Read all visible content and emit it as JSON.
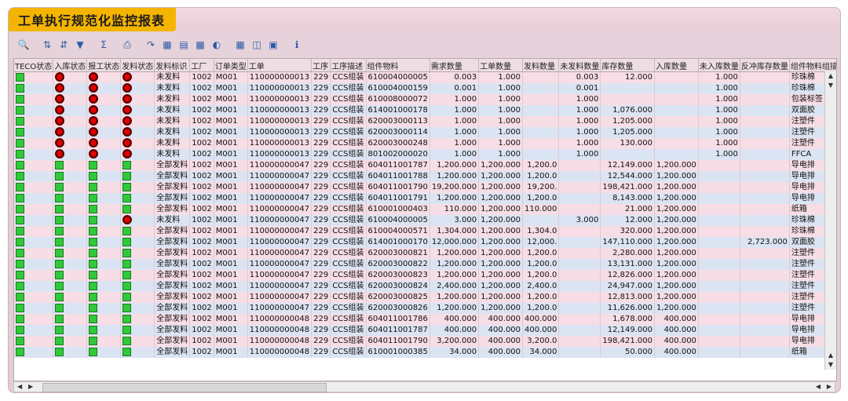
{
  "title": "工单执行规范化监控报表",
  "toolbar": {
    "icons": [
      "details-icon",
      "sort-ascending-icon",
      "sort-descending-icon",
      "filter-icon",
      "sum-icon",
      "print-icon",
      "export-icon",
      "spreadsheet-icon",
      "word-processing-icon",
      "graphic-icon",
      "abc-analysis-icon",
      "layout-icon",
      "select-layout-icon",
      "save-layout-icon",
      "info-icon"
    ]
  },
  "table": {
    "columns": [
      "TECO状态",
      "入库状态",
      "报工状态",
      "发料状态",
      "发料标识",
      "工厂",
      "订单类型",
      "工单",
      "工序",
      "工序描述",
      "组件物料",
      "需求数量",
      "工单数量",
      "发料数量",
      "未发料数量",
      "库存数量",
      "入库数量",
      "未入库数量",
      "反冲库存数量",
      "组件物料组描"
    ],
    "rows": [
      {
        "teco": "g",
        "in": "r",
        "rep": "r",
        "iss": "r",
        "flag": "未发料",
        "plant": "1002",
        "type": "M001",
        "order": "110000000013",
        "op": "229",
        "opdesc": "CCS组装",
        "mat": "610004000005",
        "req": "0.003",
        "ord": "1.000",
        "isq": "",
        "unis": "0.003",
        "stock": "12.000",
        "inq": "",
        "unin": "1.000",
        "back": "",
        "grp": "珍珠棉"
      },
      {
        "teco": "g",
        "in": "r",
        "rep": "r",
        "iss": "r",
        "flag": "未发料",
        "plant": "1002",
        "type": "M001",
        "order": "110000000013",
        "op": "229",
        "opdesc": "CCS组装",
        "mat": "610004000159",
        "req": "0.001",
        "ord": "1.000",
        "isq": "",
        "unis": "0.001",
        "stock": "",
        "inq": "",
        "unin": "1.000",
        "back": "",
        "grp": "珍珠棉"
      },
      {
        "teco": "g",
        "in": "r",
        "rep": "r",
        "iss": "r",
        "flag": "未发料",
        "plant": "1002",
        "type": "M001",
        "order": "110000000013",
        "op": "229",
        "opdesc": "CCS组装",
        "mat": "610008000072",
        "req": "1.000",
        "ord": "1.000",
        "isq": "",
        "unis": "1.000",
        "stock": "",
        "inq": "",
        "unin": "1.000",
        "back": "",
        "grp": "包装标签"
      },
      {
        "teco": "g",
        "in": "r",
        "rep": "r",
        "iss": "r",
        "flag": "未发料",
        "plant": "1002",
        "type": "M001",
        "order": "110000000013",
        "op": "229",
        "opdesc": "CCS组装",
        "mat": "614001000178",
        "req": "1.000",
        "ord": "1.000",
        "isq": "",
        "unis": "1.000",
        "stock": "1,076.000",
        "inq": "",
        "unin": "1.000",
        "back": "",
        "grp": "双面胶"
      },
      {
        "teco": "g",
        "in": "r",
        "rep": "r",
        "iss": "r",
        "flag": "未发料",
        "plant": "1002",
        "type": "M001",
        "order": "110000000013",
        "op": "229",
        "opdesc": "CCS组装",
        "mat": "620003000113",
        "req": "1.000",
        "ord": "1.000",
        "isq": "",
        "unis": "1.000",
        "stock": "1,205.000",
        "inq": "",
        "unin": "1.000",
        "back": "",
        "grp": "注塑件"
      },
      {
        "teco": "g",
        "in": "r",
        "rep": "r",
        "iss": "r",
        "flag": "未发料",
        "plant": "1002",
        "type": "M001",
        "order": "110000000013",
        "op": "229",
        "opdesc": "CCS组装",
        "mat": "620003000114",
        "req": "1.000",
        "ord": "1.000",
        "isq": "",
        "unis": "1.000",
        "stock": "1,205.000",
        "inq": "",
        "unin": "1.000",
        "back": "",
        "grp": "注塑件"
      },
      {
        "teco": "g",
        "in": "r",
        "rep": "r",
        "iss": "r",
        "flag": "未发料",
        "plant": "1002",
        "type": "M001",
        "order": "110000000013",
        "op": "229",
        "opdesc": "CCS组装",
        "mat": "620003000248",
        "req": "1.000",
        "ord": "1.000",
        "isq": "",
        "unis": "1.000",
        "stock": "130.000",
        "inq": "",
        "unin": "1.000",
        "back": "",
        "grp": "注塑件"
      },
      {
        "teco": "g",
        "in": "r",
        "rep": "r",
        "iss": "r",
        "flag": "未发料",
        "plant": "1002",
        "type": "M001",
        "order": "110000000013",
        "op": "229",
        "opdesc": "CCS组装",
        "mat": "801002000020",
        "req": "1.000",
        "ord": "1.000",
        "isq": "",
        "unis": "1.000",
        "stock": "",
        "inq": "",
        "unin": "1.000",
        "back": "",
        "grp": "FFCA"
      },
      {
        "teco": "g",
        "in": "g",
        "rep": "g",
        "iss": "g",
        "flag": "全部发料",
        "plant": "1002",
        "type": "M001",
        "order": "110000000047",
        "op": "229",
        "opdesc": "CCS组装",
        "mat": "604011001787",
        "req": "1,200.000",
        "ord": "1,200.000",
        "isq": "1,200.0",
        "unis": "",
        "stock": "12,149.000",
        "inq": "1,200.000",
        "unin": "",
        "back": "",
        "grp": "导电排"
      },
      {
        "teco": "g",
        "in": "g",
        "rep": "g",
        "iss": "g",
        "flag": "全部发料",
        "plant": "1002",
        "type": "M001",
        "order": "110000000047",
        "op": "229",
        "opdesc": "CCS组装",
        "mat": "604011001788",
        "req": "1,200.000",
        "ord": "1,200.000",
        "isq": "1,200.0",
        "unis": "",
        "stock": "12,544.000",
        "inq": "1,200.000",
        "unin": "",
        "back": "",
        "grp": "导电排"
      },
      {
        "teco": "g",
        "in": "g",
        "rep": "g",
        "iss": "g",
        "flag": "全部发料",
        "plant": "1002",
        "type": "M001",
        "order": "110000000047",
        "op": "229",
        "opdesc": "CCS组装",
        "mat": "604011001790",
        "req": "19,200.000",
        "ord": "1,200.000",
        "isq": "19,200.",
        "unis": "",
        "stock": "198,421.000",
        "inq": "1,200.000",
        "unin": "",
        "back": "",
        "grp": "导电排"
      },
      {
        "teco": "g",
        "in": "g",
        "rep": "g",
        "iss": "g",
        "flag": "全部发料",
        "plant": "1002",
        "type": "M001",
        "order": "110000000047",
        "op": "229",
        "opdesc": "CCS组装",
        "mat": "604011001791",
        "req": "1,200.000",
        "ord": "1,200.000",
        "isq": "1,200.0",
        "unis": "",
        "stock": "8,143.000",
        "inq": "1,200.000",
        "unin": "",
        "back": "",
        "grp": "导电排"
      },
      {
        "teco": "g",
        "in": "g",
        "rep": "g",
        "iss": "g",
        "flag": "全部发料",
        "plant": "1002",
        "type": "M001",
        "order": "110000000047",
        "op": "229",
        "opdesc": "CCS组装",
        "mat": "610001000403",
        "req": "110.000",
        "ord": "1,200.000",
        "isq": "110.000",
        "unis": "",
        "stock": "21.000",
        "inq": "1,200.000",
        "unin": "",
        "back": "",
        "grp": "纸箱"
      },
      {
        "teco": "g",
        "in": "g",
        "rep": "g",
        "iss": "r",
        "flag": "未发料",
        "plant": "1002",
        "type": "M001",
        "order": "110000000047",
        "op": "229",
        "opdesc": "CCS组装",
        "mat": "610004000005",
        "req": "3.000",
        "ord": "1,200.000",
        "isq": "",
        "unis": "3.000",
        "stock": "12.000",
        "inq": "1,200.000",
        "unin": "",
        "back": "",
        "grp": "珍珠棉"
      },
      {
        "teco": "g",
        "in": "g",
        "rep": "g",
        "iss": "g",
        "flag": "全部发料",
        "plant": "1002",
        "type": "M001",
        "order": "110000000047",
        "op": "229",
        "opdesc": "CCS组装",
        "mat": "610004000571",
        "req": "1,304.000",
        "ord": "1,200.000",
        "isq": "1,304.0",
        "unis": "",
        "stock": "320.000",
        "inq": "1,200.000",
        "unin": "",
        "back": "",
        "grp": "珍珠棉"
      },
      {
        "teco": "g",
        "in": "g",
        "rep": "g",
        "iss": "g",
        "flag": "全部发料",
        "plant": "1002",
        "type": "M001",
        "order": "110000000047",
        "op": "229",
        "opdesc": "CCS组装",
        "mat": "614001000170",
        "req": "12,000.000",
        "ord": "1,200.000",
        "isq": "12,000.",
        "unis": "",
        "stock": "147,110.000",
        "inq": "1,200.000",
        "unin": "",
        "back": "2,723.000",
        "grp": "双面胶"
      },
      {
        "teco": "g",
        "in": "g",
        "rep": "g",
        "iss": "g",
        "flag": "全部发料",
        "plant": "1002",
        "type": "M001",
        "order": "110000000047",
        "op": "229",
        "opdesc": "CCS组装",
        "mat": "620003000821",
        "req": "1,200.000",
        "ord": "1,200.000",
        "isq": "1,200.0",
        "unis": "",
        "stock": "2,280.000",
        "inq": "1,200.000",
        "unin": "",
        "back": "",
        "grp": "注塑件"
      },
      {
        "teco": "g",
        "in": "g",
        "rep": "g",
        "iss": "g",
        "flag": "全部发料",
        "plant": "1002",
        "type": "M001",
        "order": "110000000047",
        "op": "229",
        "opdesc": "CCS组装",
        "mat": "620003000822",
        "req": "1,200.000",
        "ord": "1,200.000",
        "isq": "1,200.0",
        "unis": "",
        "stock": "13,131.000",
        "inq": "1,200.000",
        "unin": "",
        "back": "",
        "grp": "注塑件"
      },
      {
        "teco": "g",
        "in": "g",
        "rep": "g",
        "iss": "g",
        "flag": "全部发料",
        "plant": "1002",
        "type": "M001",
        "order": "110000000047",
        "op": "229",
        "opdesc": "CCS组装",
        "mat": "620003000823",
        "req": "1,200.000",
        "ord": "1,200.000",
        "isq": "1,200.0",
        "unis": "",
        "stock": "12,826.000",
        "inq": "1,200.000",
        "unin": "",
        "back": "",
        "grp": "注塑件"
      },
      {
        "teco": "g",
        "in": "g",
        "rep": "g",
        "iss": "g",
        "flag": "全部发料",
        "plant": "1002",
        "type": "M001",
        "order": "110000000047",
        "op": "229",
        "opdesc": "CCS组装",
        "mat": "620003000824",
        "req": "2,400.000",
        "ord": "1,200.000",
        "isq": "2,400.0",
        "unis": "",
        "stock": "24,947.000",
        "inq": "1,200.000",
        "unin": "",
        "back": "",
        "grp": "注塑件"
      },
      {
        "teco": "g",
        "in": "g",
        "rep": "g",
        "iss": "g",
        "flag": "全部发料",
        "plant": "1002",
        "type": "M001",
        "order": "110000000047",
        "op": "229",
        "opdesc": "CCS组装",
        "mat": "620003000825",
        "req": "1,200.000",
        "ord": "1,200.000",
        "isq": "1,200.0",
        "unis": "",
        "stock": "12,813.000",
        "inq": "1,200.000",
        "unin": "",
        "back": "",
        "grp": "注塑件"
      },
      {
        "teco": "g",
        "in": "g",
        "rep": "g",
        "iss": "g",
        "flag": "全部发料",
        "plant": "1002",
        "type": "M001",
        "order": "110000000047",
        "op": "229",
        "opdesc": "CCS组装",
        "mat": "620003000826",
        "req": "1,200.000",
        "ord": "1,200.000",
        "isq": "1,200.0",
        "unis": "",
        "stock": "11,626.000",
        "inq": "1,200.000",
        "unin": "",
        "back": "",
        "grp": "注塑件"
      },
      {
        "teco": "g",
        "in": "g",
        "rep": "g",
        "iss": "g",
        "flag": "全部发料",
        "plant": "1002",
        "type": "M001",
        "order": "110000000048",
        "op": "229",
        "opdesc": "CCS组装",
        "mat": "604011001786",
        "req": "400.000",
        "ord": "400.000",
        "isq": "400.000",
        "unis": "",
        "stock": "1,678.000",
        "inq": "400.000",
        "unin": "",
        "back": "",
        "grp": "导电排"
      },
      {
        "teco": "g",
        "in": "g",
        "rep": "g",
        "iss": "g",
        "flag": "全部发料",
        "plant": "1002",
        "type": "M001",
        "order": "110000000048",
        "op": "229",
        "opdesc": "CCS组装",
        "mat": "604011001787",
        "req": "400.000",
        "ord": "400.000",
        "isq": "400.000",
        "unis": "",
        "stock": "12,149.000",
        "inq": "400.000",
        "unin": "",
        "back": "",
        "grp": "导电排"
      },
      {
        "teco": "g",
        "in": "g",
        "rep": "g",
        "iss": "g",
        "flag": "全部发料",
        "plant": "1002",
        "type": "M001",
        "order": "110000000048",
        "op": "229",
        "opdesc": "CCS组装",
        "mat": "604011001790",
        "req": "3,200.000",
        "ord": "400.000",
        "isq": "3,200.0",
        "unis": "",
        "stock": "198,421.000",
        "inq": "400.000",
        "unin": "",
        "back": "",
        "grp": "导电排"
      },
      {
        "teco": "g",
        "in": "g",
        "rep": "g",
        "iss": "g",
        "flag": "全部发料",
        "plant": "1002",
        "type": "M001",
        "order": "110000000048",
        "op": "229",
        "opdesc": "CCS组装",
        "mat": "610001000385",
        "req": "34.000",
        "ord": "400.000",
        "isq": "34.000",
        "unis": "",
        "stock": "50.000",
        "inq": "400.000",
        "unin": "",
        "back": "",
        "grp": "纸箱"
      }
    ]
  }
}
